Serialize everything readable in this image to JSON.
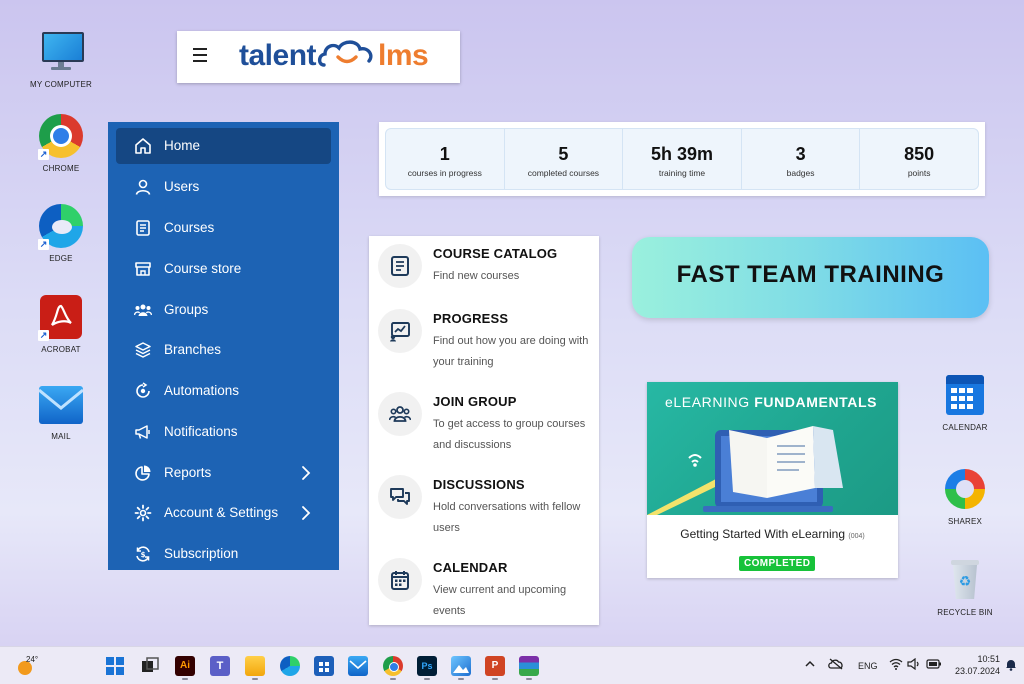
{
  "desktop": {
    "icons_left": [
      {
        "label": "MY COMPUTER",
        "icon": "monitor-icon"
      },
      {
        "label": "CHROME",
        "icon": "chrome-icon"
      },
      {
        "label": "EDGE",
        "icon": "edge-icon"
      },
      {
        "label": "ACROBAT",
        "icon": "acrobat-icon"
      },
      {
        "label": "MAIL",
        "icon": "mail-icon"
      }
    ],
    "icons_right": [
      {
        "label": "CALENDAR",
        "icon": "calendar-icon"
      },
      {
        "label": "SHAREX",
        "icon": "sharex-icon"
      },
      {
        "label": "RECYCLE BIN",
        "icon": "recycle-bin-icon"
      }
    ]
  },
  "logo": {
    "part1": "talent",
    "part2": "lms"
  },
  "sidebar": {
    "items": [
      {
        "label": "Home",
        "icon": "home-icon",
        "active": true
      },
      {
        "label": "Users",
        "icon": "user-icon"
      },
      {
        "label": "Courses",
        "icon": "book-icon"
      },
      {
        "label": "Course store",
        "icon": "store-icon"
      },
      {
        "label": "Groups",
        "icon": "groups-icon"
      },
      {
        "label": "Branches",
        "icon": "layers-icon"
      },
      {
        "label": "Automations",
        "icon": "automation-icon"
      },
      {
        "label": "Notifications",
        "icon": "megaphone-icon"
      },
      {
        "label": "Reports",
        "icon": "pie-chart-icon",
        "submenu": true
      },
      {
        "label": "Account & Settings",
        "icon": "gear-icon",
        "submenu": true
      },
      {
        "label": "Subscription",
        "icon": "subscription-icon"
      }
    ]
  },
  "stats": [
    {
      "value": "1",
      "label": "courses in progress"
    },
    {
      "value": "5",
      "label": "completed courses"
    },
    {
      "value": "5h 39m",
      "label": "training time"
    },
    {
      "value": "3",
      "label": "badges"
    },
    {
      "value": "850",
      "label": "points"
    }
  ],
  "menu": [
    {
      "title": "COURSE CATALOG",
      "desc": "Find new courses",
      "icon": "catalog-icon"
    },
    {
      "title": "PROGRESS",
      "desc": "Find out how you are doing with your training",
      "icon": "progress-icon"
    },
    {
      "title": "JOIN GROUP",
      "desc": "To get access to group courses and discussions",
      "icon": "join-group-icon"
    },
    {
      "title": "DISCUSSIONS",
      "desc": "Hold conversations with fellow users",
      "icon": "discussions-icon"
    },
    {
      "title": "CALENDAR",
      "desc": "View current and upcoming events",
      "icon": "calendar-icon"
    }
  ],
  "banner": {
    "text": "FAST TEAM TRAINING"
  },
  "course": {
    "header_light": "eLEARNING",
    "header_bold": "FUNDAMENTALS",
    "title": "Getting Started With eLearning",
    "code": "(004)",
    "status": "COMPLETED"
  },
  "taskbar": {
    "weather": "24°",
    "lang": "ENG",
    "time": "10:51",
    "date": "23.07.2024",
    "apps": [
      "start-icon",
      "task-view-icon",
      "illustrator-icon",
      "teams-icon",
      "file-explorer-icon",
      "edge-icon",
      "store-icon",
      "mail-icon",
      "chrome-icon",
      "photoshop-icon",
      "photos-icon",
      "powerpoint-icon",
      "winrar-icon"
    ]
  },
  "colors": {
    "sidebar": "#1d63b4",
    "sidebar_active": "#154783",
    "logo_blue": "#1f4f99",
    "logo_orange": "#ee7d2f",
    "completed_green": "#17c23a"
  }
}
